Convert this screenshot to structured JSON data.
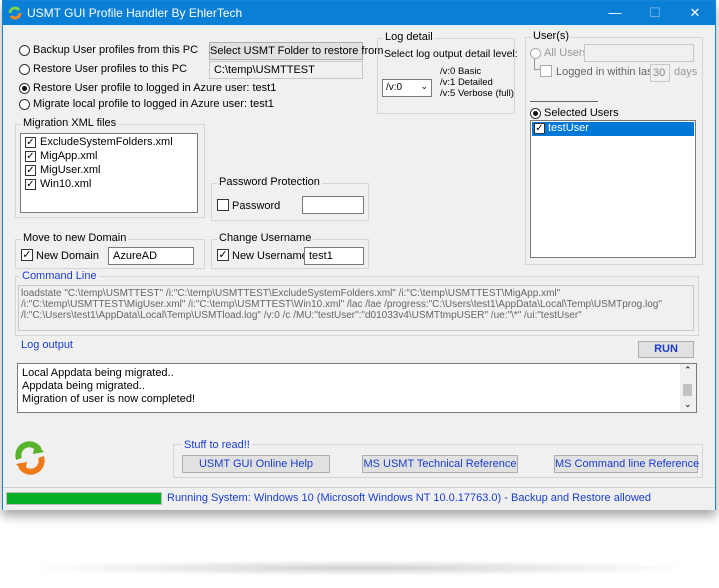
{
  "window": {
    "title": "USMT GUI Profile Handler By EhlerTech",
    "min_symbol": "—",
    "max_symbol": "☐",
    "close_symbol": "✕"
  },
  "profile_options": {
    "backup_label": "Backup User profiles from this PC",
    "restore_label": "Restore User profiles to this PC",
    "restore_azure_label": "Restore User profile to logged in Azure user: test1",
    "migrate_local_label": "Migrate local profile to logged in Azure user: test1",
    "select_folder_button": "Select USMT Folder to restore from",
    "folder_path": "C:\\temp\\USMTTEST",
    "selected": "restore_azure"
  },
  "migration_files": {
    "title": "Migration XML files",
    "items": [
      {
        "label": "ExcludeSystemFolders.xml",
        "checked": true
      },
      {
        "label": "MigApp.xml",
        "checked": true
      },
      {
        "label": "MigUser.xml",
        "checked": true
      },
      {
        "label": "Win10.xml",
        "checked": true
      }
    ]
  },
  "log_detail": {
    "title": "Log detail",
    "label": "Select log output detail level:",
    "selected": "/v:0",
    "options_text": [
      "/v:0 Basic",
      "/v:1 Detailed",
      "/v:5 Verbose (full)"
    ]
  },
  "users": {
    "title": "User(s)",
    "all_users_label": "All Users",
    "logged_within_label": "Logged in within last",
    "days_value": "30",
    "days_label": "days",
    "selected_users_label": "Selected Users",
    "list": [
      {
        "label": "testUser",
        "checked": true
      }
    ]
  },
  "password": {
    "title": "Password Protection",
    "label": "Password",
    "value": ""
  },
  "domain": {
    "title": "Move to new Domain",
    "label": "New Domain",
    "value": "AzureAD",
    "checked": true
  },
  "username": {
    "title": "Change Username",
    "label": "New Username",
    "value": "test1",
    "checked": true
  },
  "command_line": {
    "title": "Command Line",
    "text": "loadstate \"C:\\temp\\USMTTEST\" /i:\"C:\\temp\\USMTTEST\\ExcludeSystemFolders.xml\" /i:\"C:\\temp\\USMTTEST\\MigApp.xml\" /i:\"C:\\temp\\USMTTEST\\MigUser.xml\" /i:\"C:\\temp\\USMTTEST\\Win10.xml\" /lac /lae /progress:\"C:\\Users\\test1\\AppData\\Local\\Temp\\USMTprog.log\" /l:\"C:\\Users\\test1\\AppData\\Local\\Temp\\USMTload.log\" /v:0  /c /MU:\"testUser\":\"d01033v4\\USMTtmpUSER\" /ue:\"\\*\" /ui:\"testUser\""
  },
  "log_output": {
    "title": "Log output",
    "run_button": "RUN",
    "lines": [
      "Local Appdata being migrated..",
      "Appdata being migrated..",
      "Migration of user is now completed!"
    ]
  },
  "links": {
    "title": "Stuff to read!!",
    "online_help": "USMT GUI Online Help",
    "technical_reference": "MS USMT Technical Reference",
    "command_line_reference": "MS Command line Reference"
  },
  "status_bar": {
    "text": "Running System: Windows 10  (Microsoft Windows NT 10.0.17763.0) - Backup and Restore allowed",
    "progress": 1.0
  },
  "colors": {
    "title_bar": "#0a7fd6",
    "selection": "#0078d7",
    "progress": "#06b025",
    "group_title_blue": "#1a3dcc"
  }
}
